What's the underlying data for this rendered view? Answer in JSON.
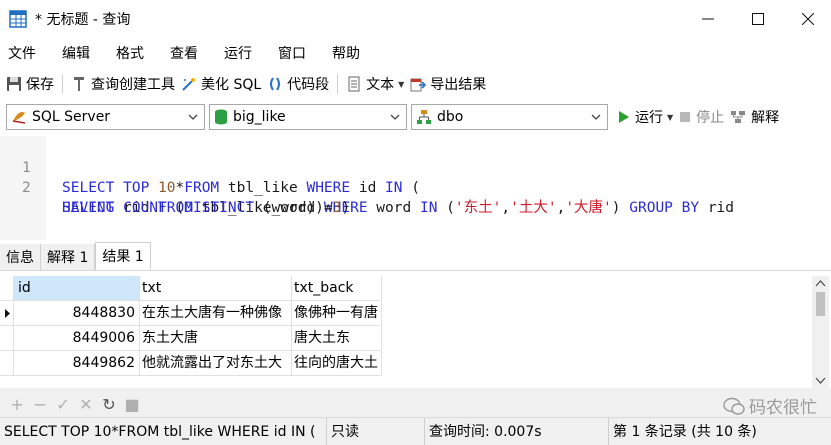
{
  "window": {
    "title": "* 无标题 - 查询",
    "controls": [
      "minimize-icon",
      "maximize-icon",
      "close-icon"
    ]
  },
  "menu": [
    "文件",
    "编辑",
    "格式",
    "查看",
    "运行",
    "窗口",
    "帮助"
  ],
  "toolbar": {
    "save": "保存",
    "query_builder": "查询创建工具",
    "beautify": "美化 SQL",
    "snippet": "代码段",
    "text": "文本",
    "export": "导出结果"
  },
  "connection": {
    "server": "SQL Server",
    "database": "big_like",
    "schema": "dbo",
    "run": "运行",
    "stop": "停止",
    "explain": "解释"
  },
  "editor": {
    "line_numbers": [
      "1",
      "2"
    ],
    "line1": {
      "kw1": "SELECT TOP ",
      "num": "10",
      "t1": "*",
      "kw2": "FROM",
      "t2": " tbl_like ",
      "kw3": "WHERE",
      "t3": " id ",
      "kw4": "IN",
      "t4": " ("
    },
    "line2": {
      "kw1": "SELECT",
      "t1": " rid ",
      "kw2": "FROM",
      "t2": " tbl_like_word ",
      "kw3": "WHERE",
      "t3": " word ",
      "kw4": "IN",
      "t4": " (",
      "s1": "'东土'",
      "c1": ",",
      "s2": "'土大'",
      "c2": ",",
      "s3": "'大唐'",
      "t5": ") ",
      "kw5": "GROUP BY",
      "t6": " rid"
    },
    "line3": {
      "kw1": "HAVING COUNT",
      "t1": " (",
      "kw2": "DISTINCT",
      "t2": " (word))=",
      "num": "3",
      "t3": ")"
    }
  },
  "tabs": [
    "信息",
    "解释 1",
    "结果 1"
  ],
  "active_tab": "结果 1",
  "grid": {
    "columns": [
      "id",
      "txt",
      "txt_back"
    ],
    "rows": [
      [
        "8448830",
        "在东土大唐有一种佛像",
        "像佛种一有唐"
      ],
      [
        "8449006",
        "东土大唐",
        "唐大土东"
      ],
      [
        "8449862",
        "他就流露出了对东土大",
        "往向的唐大土"
      ]
    ]
  },
  "nav_buttons": [
    "+",
    "−",
    "✓",
    "✕",
    "↻",
    "■"
  ],
  "watermark": "码农很忙",
  "status": {
    "sql": "SELECT TOP 10*FROM tbl_like WHERE id IN (",
    "mode": "只读",
    "time": "查询时间: 0.007s",
    "records": "第 1 条记录 (共 10 条)"
  },
  "colors": {
    "keyword": "#2b2bd8",
    "string": "#d11a2a",
    "number": "#8b5a2b",
    "run_green": "#2aa12a",
    "header_selected": "#cfe6fb"
  }
}
